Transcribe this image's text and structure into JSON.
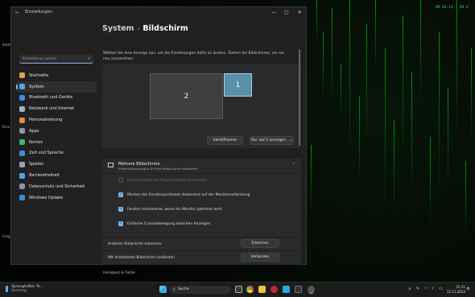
{
  "window": {
    "title": "Einstellungen",
    "back_glyph": "←",
    "minimize_glyph": "—",
    "maximize_glyph": "▢",
    "close_glyph": "✕"
  },
  "sidebar": {
    "search_placeholder": "Einstellung suchen",
    "search_icon": "search-icon",
    "items": [
      {
        "label": "Startseite",
        "icon": "home-icon",
        "color": "#e0a050",
        "active": false
      },
      {
        "label": "System",
        "icon": "system-icon",
        "color": "#4aa8e8",
        "active": true
      },
      {
        "label": "Bluetooth und Geräte",
        "icon": "bluetooth-icon",
        "color": "#3a8fd8",
        "active": false
      },
      {
        "label": "Netzwerk und Internet",
        "icon": "wifi-icon",
        "color": "#9fb4c8",
        "active": false
      },
      {
        "label": "Personalisierung",
        "icon": "brush-icon",
        "color": "#e08a4a",
        "active": false
      },
      {
        "label": "Apps",
        "icon": "apps-icon",
        "color": "#8a95a8",
        "active": false
      },
      {
        "label": "Konten",
        "icon": "account-icon",
        "color": "#3cb47a",
        "active": false
      },
      {
        "label": "Zeit und Sprache",
        "icon": "globe-clock-icon",
        "color": "#3a8fd8",
        "active": false
      },
      {
        "label": "Spielen",
        "icon": "gamepad-icon",
        "color": "#9aa4b4",
        "active": false
      },
      {
        "label": "Barrierefreiheit",
        "icon": "accessibility-icon",
        "color": "#4aa8e8",
        "active": false
      },
      {
        "label": "Datenschutz und Sicherheit",
        "icon": "shield-icon",
        "color": "#8a95a8",
        "active": false
      },
      {
        "label": "Windows Update",
        "icon": "update-icon",
        "color": "#3a8fd8",
        "active": false
      }
    ]
  },
  "content": {
    "breadcrumb_parent": "System",
    "breadcrumb_sep": "›",
    "breadcrumb_current": "Bildschirm",
    "description": "Wählen Sie eine Anzeige aus, um die Einstellungen dafür zu ändern. Ziehen Sie Bildschirme, um sie neu anzuordnen.",
    "monitor_2_label": "2",
    "monitor_1_label": "1",
    "identify_button": "Identifizieren",
    "display_mode_select": "Nur auf 2 anzeigen",
    "dropdown_glyph": "⌄",
    "multi_section": {
      "title": "Mehrere Bildschirme",
      "subtitle": "Präsentationsmodus für Ihre Bildschirme auswählen",
      "chevron_glyph": "⌃",
      "options": [
        {
          "label": "Diese Anzeige als Hauptanzeige verwenden",
          "checked": false,
          "disabled": true
        },
        {
          "label": "Merken der Fensterpositionen basierend auf der Monitorverbindung",
          "checked": true,
          "disabled": false
        },
        {
          "label": "Fenster minimieren, wenn ein Monitor getrennt wird",
          "checked": true,
          "disabled": false
        },
        {
          "label": "Einfache Cursorbewegung zwischen Anzeigen",
          "checked": true,
          "disabled": false
        }
      ],
      "detect_label": "Anderen Bildschirm erkennen",
      "detect_button": "Erkennen",
      "wireless_label": "Mit drahtlosem Bildschirm verbinden",
      "wireless_button": "Verbinden"
    },
    "more_heading": "Helligkeit & Farbe"
  },
  "desktop": {
    "overlay_clock": "89 01:11 · 49 %",
    "side_labels": [
      "Batte",
      "Broo",
      "Insig"
    ]
  },
  "taskbar": {
    "weather_title": "Sprunghafter Te...",
    "weather_sub": "Sonntag",
    "search_label": "Suche",
    "search_icon": "search-icon",
    "clock_time": "01:11",
    "clock_date": "22.11.2024",
    "tray_chevron": "∧",
    "tray_wifi": "wifi-icon",
    "tray_volume": "volume-icon",
    "tray_battery": "battery-icon",
    "tray_bell": "bell-icon",
    "tray_pen": "pen-icon"
  }
}
